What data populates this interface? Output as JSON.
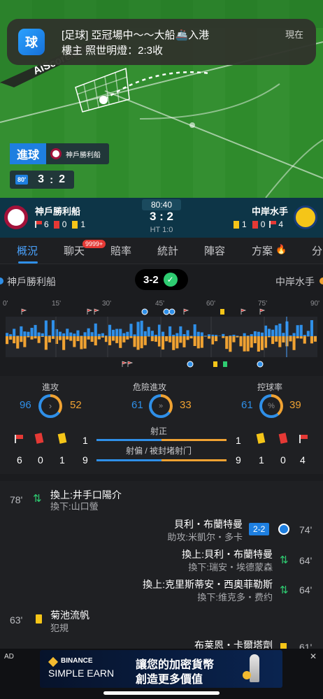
{
  "notification": {
    "app_icon_text": "球",
    "title": "[足球] 亞冠場中～～大船🚢入港",
    "body": "樓主 照世明燈：2:3收",
    "time": "現在"
  },
  "field": {
    "watermark": "AiScore.com",
    "goal_label": "進球",
    "goal_team": "神戶勝利船",
    "minute_badge": "80'",
    "home_score": "3",
    "separator": ":",
    "away_score": "2"
  },
  "scorebar": {
    "home_team": "神戶勝利船",
    "away_team": "中岸水手",
    "clock": "80:40",
    "score": "3 : 2",
    "ht": "HT 1:0",
    "home_corners": "6",
    "home_red": "0",
    "home_yellow": "1",
    "away_yellow": "1",
    "away_red": "0",
    "away_corners": "4"
  },
  "tabs": {
    "items": [
      "概況",
      "聊天",
      "賠率",
      "統計",
      "陣容",
      "方案",
      "分"
    ],
    "chat_badge": "9999+",
    "active": "概況"
  },
  "momentum": {
    "home_team": "神戶勝利船",
    "away_team": "中岸水手",
    "score": "3-2",
    "timeline_labels": [
      "0'",
      "15'",
      "30'",
      "45'",
      "60'",
      "75'",
      "90'"
    ]
  },
  "stats": {
    "attack_label": "進攻",
    "attack_home": "96",
    "attack_away": "52",
    "danger_label": "危險進攻",
    "danger_home": "61",
    "danger_away": "33",
    "possession_label": "控球率",
    "possession_home": "61",
    "possession_away": "39",
    "possession_icon_text": "%",
    "on_target_label": "射正",
    "on_target_home": "1",
    "on_target_away": "1",
    "off_target_label": "射偏 / 被封堵射门",
    "off_target_home": "9",
    "off_target_away": "9",
    "home_corners": "6",
    "home_red": "0",
    "home_yellow": "1",
    "away_yellow": "1",
    "away_red": "0",
    "away_corners": "4"
  },
  "events": [
    {
      "minute": "78'",
      "line1": "換上:井手口陽介",
      "line2": "換下:山口螢"
    },
    {
      "minute": "74'",
      "line1": "貝利・布蘭特曼",
      "line2": "助攻:米凱尔・多卡",
      "score": "2-2"
    },
    {
      "minute": "64'",
      "line1": "換上:貝利・布蘭特曼",
      "line2": "換下:瑞安・埃德蒙森"
    },
    {
      "minute": "64'",
      "line1": "換上:克里斯蒂安・西奧菲勒斯",
      "line2": "換下:维克多・费约"
    },
    {
      "minute": "63'",
      "line1": "菊池流帆",
      "line2": "犯規"
    },
    {
      "minute": "61'",
      "line1": "布莱恩・卡爾塔劑",
      "line2": ""
    }
  ],
  "ad": {
    "tag": "AD",
    "brand": "BINANCE",
    "product": "SIMPLE EARN",
    "line1": "讓您的加密貨幣",
    "line2": "創造更多價值"
  },
  "colors": {
    "home": "#2f8fe8",
    "away": "#f0a232",
    "accent": "#1e7fe0"
  }
}
